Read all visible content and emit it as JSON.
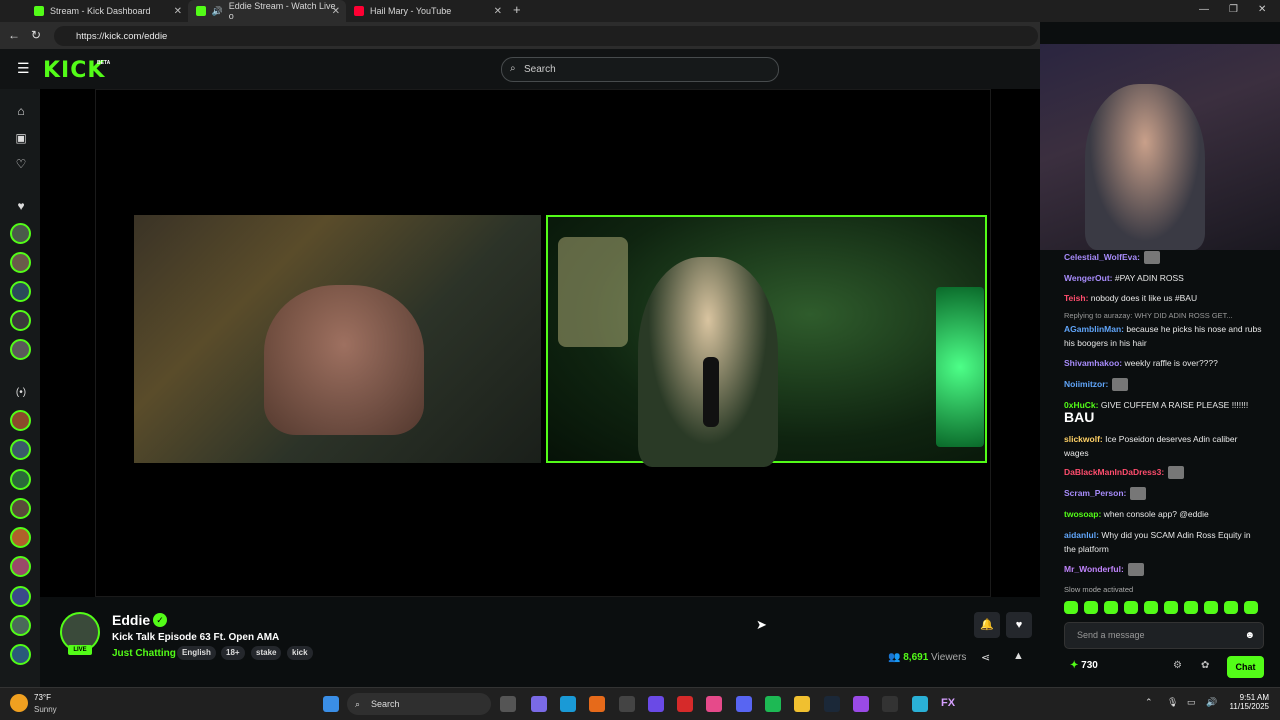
{
  "browser": {
    "tabs": [
      {
        "title": "Stream - Kick Dashboard"
      },
      {
        "title": "Eddie Stream - Watch Live o"
      },
      {
        "title": "Hail Mary - YouTube"
      }
    ],
    "url": "https://kick.com/eddie"
  },
  "header": {
    "logo": "KICK",
    "beta": "BETA",
    "search_placeholder": "Search"
  },
  "stream": {
    "streamer": "Eddie",
    "title": "Kick Talk Episode 63 Ft. Open AMA",
    "category": "Just Chatting",
    "tags": [
      "English",
      "18+",
      "stake",
      "kick"
    ],
    "live_badge": "LIVE",
    "viewers_count": "8,691",
    "viewers_label": "Viewers"
  },
  "chat": {
    "messages": [
      {
        "user": "Celestial_WolfEva:",
        "text": "",
        "color": "#a78bfa",
        "emote": true
      },
      {
        "user": "WengerOut:",
        "text": " #PAY ADIN ROSS",
        "color": "#a78bfa"
      },
      {
        "user": "Teish:",
        "text": " nobody does it like us #BAU",
        "color": "#ff4d6d"
      },
      {
        "user": "AGamblinMan:",
        "text": " because he picks his nose and rubs his boogers in his hair",
        "color": "#60a5fa"
      },
      {
        "user": "Shivamhakoo:",
        "text": " weekly raffle is over????",
        "color": "#a78bfa"
      },
      {
        "user": "Noiimitzor:",
        "text": "",
        "color": "#60a5fa",
        "emote": true
      },
      {
        "user": "0xHuCk:",
        "text": " GIVE CUFFEM A RAISE PLEASE !!!!!!!",
        "color": "#53fc18"
      },
      {
        "user": "slickwolf:",
        "text": " Ice Poseidon deserves Adin caliber wages",
        "color": "#ffd166"
      },
      {
        "user": "DaBlackManInDaDress3:",
        "text": "",
        "color": "#ff4d6d",
        "emote": true
      },
      {
        "user": "Scram_Person:",
        "text": "",
        "color": "#a78bfa",
        "emote": true
      },
      {
        "user": "twosoap:",
        "text": " when console app? @eddie",
        "color": "#53fc18"
      },
      {
        "user": "aidanlul:",
        "text": " Why did you SCAM Adin Ross Equity in the platform",
        "color": "#60a5fa"
      },
      {
        "user": "Mr_Wonderful:",
        "text": "",
        "color": "#c084fc",
        "emote": true
      }
    ],
    "reply_context": "Replying to aurazay: WHY DID ADIN ROSS GET...",
    "bau_text": "BAU",
    "slow_mode": "Slow mode activated",
    "send_placeholder": "Send a message",
    "points": "730",
    "chat_button": "Chat"
  },
  "taskbar": {
    "weather_temp": "73°F",
    "weather_cond": "Sunny",
    "search": "Search",
    "time": "9:51 AM",
    "date": "11/15/2025"
  },
  "colors": {
    "accent": "#53fc18",
    "background": "#0b0e0f"
  }
}
